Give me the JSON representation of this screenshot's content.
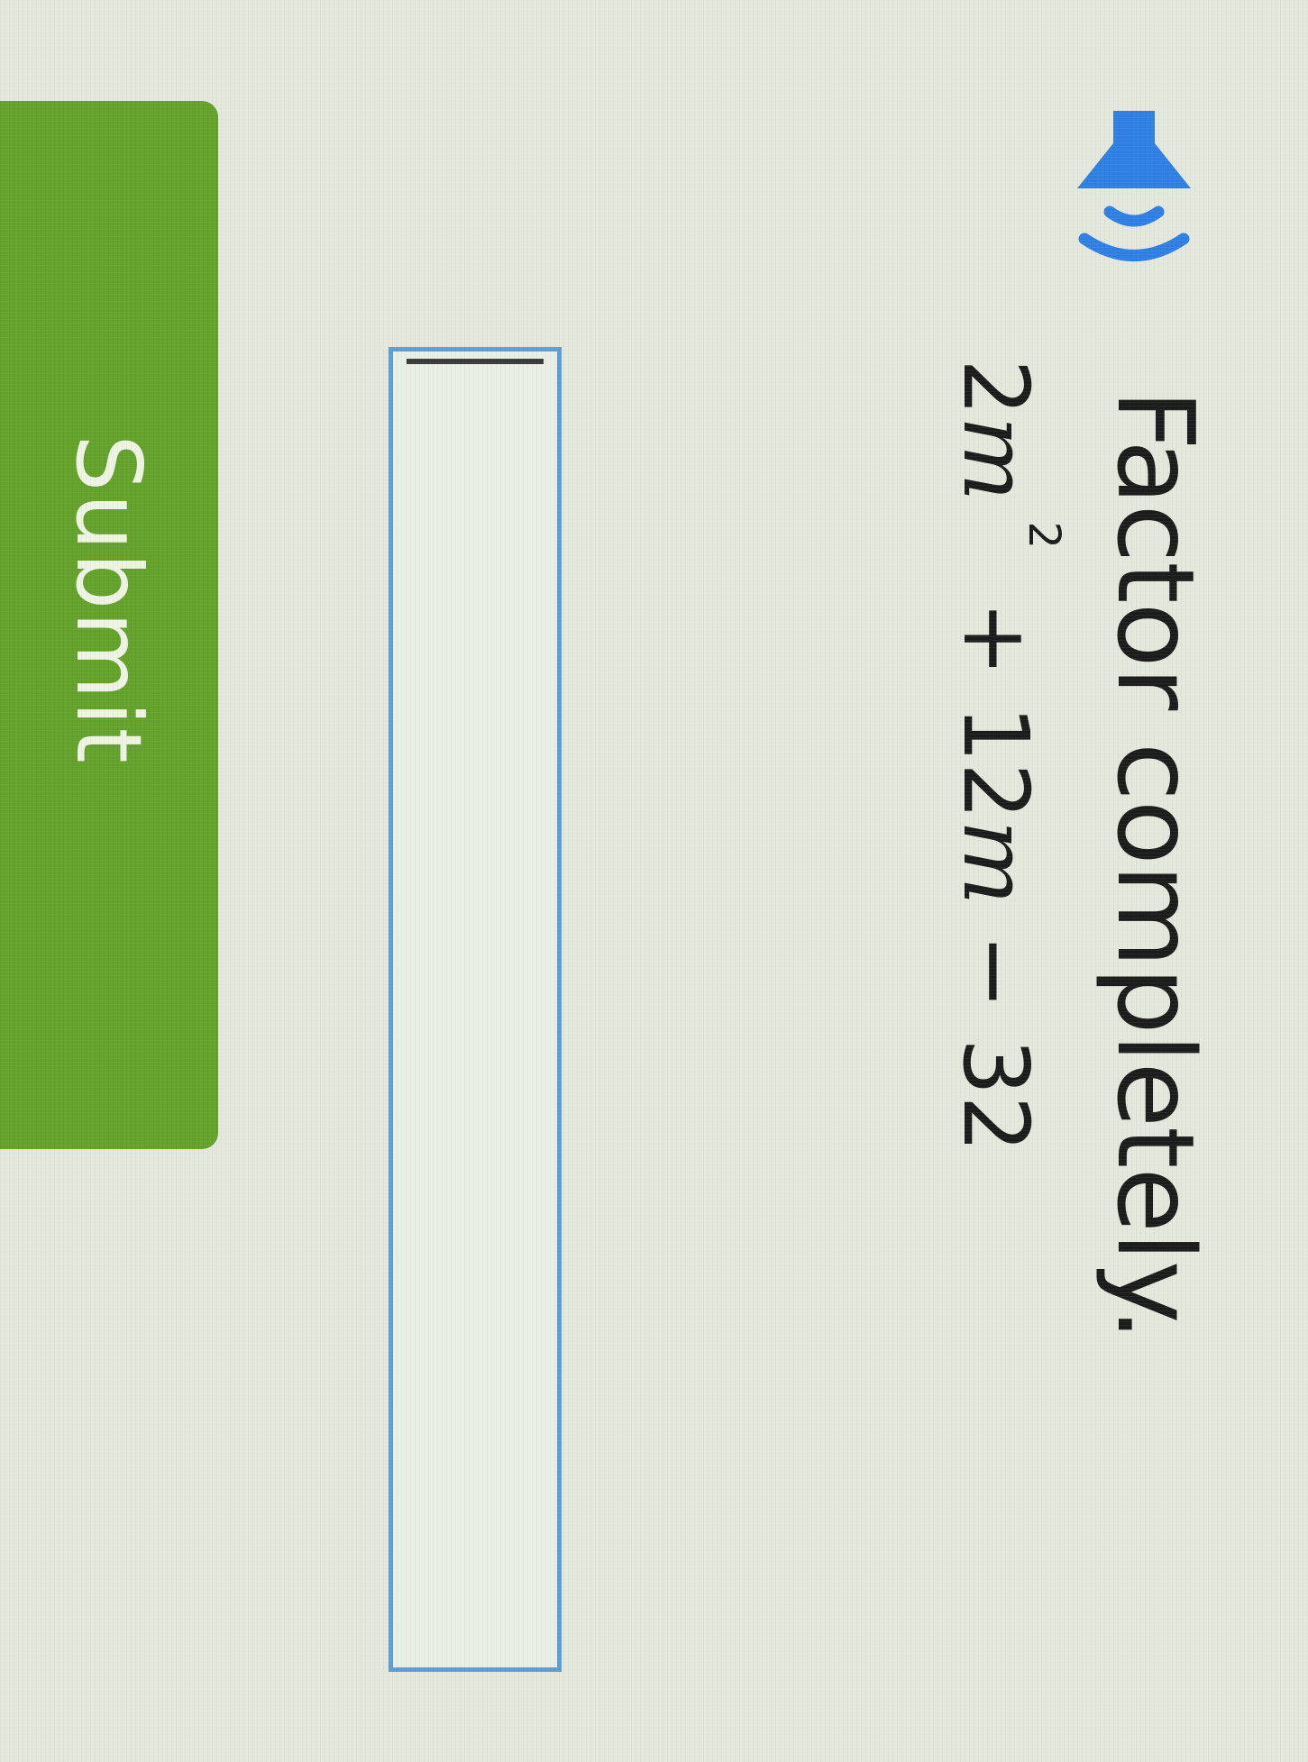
{
  "question": {
    "prompt": "Factor completely.",
    "expression": {
      "coefficient": "2",
      "variable": "m",
      "exponent": "2",
      "middle_term": " + 12",
      "constant_term": " − 32"
    }
  },
  "answer": {
    "value": "",
    "placeholder": ""
  },
  "submit": {
    "label": "Submit"
  },
  "icons": {
    "speaker": "speaker-icon"
  },
  "colors": {
    "background": "#e4e8dc",
    "speaker_icon": "#2f80e4",
    "input_border": "#5b9fd8",
    "submit_background": "#64a22b",
    "submit_text": "#eef4e4",
    "text": "#1c1c1c"
  }
}
